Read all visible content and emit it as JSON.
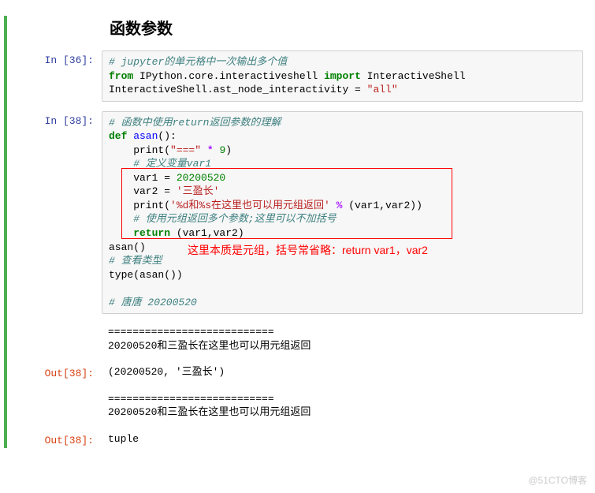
{
  "heading": "函数参数",
  "cells": {
    "c1": {
      "in_prompt": "In [36]:",
      "code": {
        "line1_comment": "# jupyter的单元格中一次输出多个值",
        "line2_from": "from",
        "line2_mod": " IPython.core.interactiveshell ",
        "line2_import": "import",
        "line2_cls": " InteractiveShell",
        "line3_a": "InteractiveShell.ast_node_interactivity = ",
        "line3_str": "\"all\""
      }
    },
    "c2": {
      "in_prompt": "In [38]:",
      "code": {
        "l1": "# 函数中使用return返回参数的理解",
        "l2_def": "def",
        "l2_name": " asan",
        "l2_paren": "():",
        "l3_call": "    print",
        "l3_paren1": "(",
        "l3_str": "\"===\"",
        "l3_op": " * ",
        "l3_num": "9",
        "l3_paren2": ")",
        "l4": "    # 定义变量var1",
        "l5_var": "    var1 = ",
        "l5_num": "20200520",
        "l6_var": "    var2 = ",
        "l6_str": "'三盈长'",
        "l7_call": "    print",
        "l7_paren1": "(",
        "l7_str": "'%d和%s在这里也可以用元组返回'",
        "l7_op": " % ",
        "l7_args": "(var1,var2))",
        "l8": "    # 使用元组返回多个参数;这里可以不加括号",
        "l9_ret": "    return",
        "l9_args": " (var1,var2)",
        "l10": "asan()",
        "l11": "# 查看类型",
        "l12": "type(asan())",
        "l13": "",
        "l14": "# 唐唐 20200520"
      },
      "annotation": "这里本质是元组，括号常省略：return var1，var2"
    },
    "out1": {
      "text": "===========================\n20200520和三盈长在这里也可以用元组返回"
    },
    "out2": {
      "prompt": "Out[38]:",
      "text": "(20200520, '三盈长')"
    },
    "out3": {
      "text": "===========================\n20200520和三盈长在这里也可以用元组返回"
    },
    "out4": {
      "prompt": "Out[38]:",
      "text": "tuple"
    }
  },
  "watermark": "@51CTO博客"
}
